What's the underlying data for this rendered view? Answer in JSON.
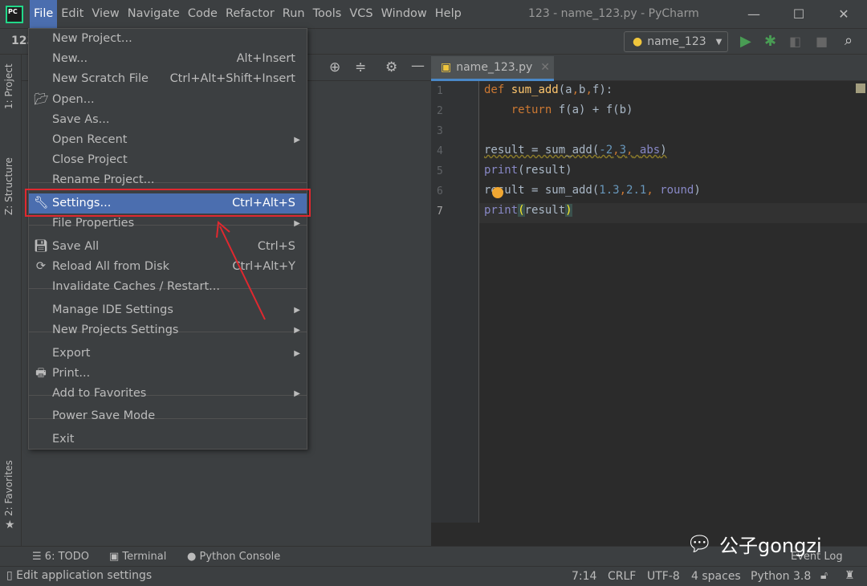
{
  "menubar": {
    "items": [
      "File",
      "Edit",
      "View",
      "Navigate",
      "Code",
      "Refactor",
      "Run",
      "Tools",
      "VCS",
      "Window",
      "Help"
    ],
    "active": "File"
  },
  "window_title": "123 - name_123.py - PyCharm",
  "project_crumb": "123",
  "run_config": "name_123",
  "left_tabs": [
    "1: Project",
    "Z: Structure",
    "2: Favorites"
  ],
  "editor": {
    "tab": "name_123.py",
    "lines": [
      "1",
      "2",
      "3",
      "4",
      "5",
      "6",
      "7"
    ],
    "current_line": 7
  },
  "file_menu": [
    {
      "label": "New Project...",
      "shortcut": "",
      "submenu": false,
      "icon": ""
    },
    {
      "label": "New...",
      "shortcut": "Alt+Insert",
      "submenu": false,
      "icon": ""
    },
    {
      "label": "New Scratch File",
      "shortcut": "Ctrl+Alt+Shift+Insert",
      "submenu": false,
      "icon": ""
    },
    {
      "label": "Open...",
      "shortcut": "",
      "submenu": false,
      "icon": "folder-icon"
    },
    {
      "label": "Save As...",
      "shortcut": "",
      "submenu": false,
      "icon": ""
    },
    {
      "label": "Open Recent",
      "shortcut": "",
      "submenu": true,
      "icon": ""
    },
    {
      "label": "Close Project",
      "shortcut": "",
      "submenu": false,
      "icon": ""
    },
    {
      "label": "Rename Project...",
      "shortcut": "",
      "submenu": false,
      "icon": ""
    },
    {
      "label": "Settings...",
      "shortcut": "Ctrl+Alt+S",
      "submenu": false,
      "icon": "wrench-icon",
      "highlighted": true
    },
    {
      "label": "File Properties",
      "shortcut": "",
      "submenu": true,
      "icon": ""
    },
    {
      "label": "Save All",
      "shortcut": "Ctrl+S",
      "submenu": false,
      "icon": "save-icon"
    },
    {
      "label": "Reload All from Disk",
      "shortcut": "Ctrl+Alt+Y",
      "submenu": false,
      "icon": "reload-icon"
    },
    {
      "label": "Invalidate Caches / Restart...",
      "shortcut": "",
      "submenu": false,
      "icon": ""
    },
    {
      "label": "Manage IDE Settings",
      "shortcut": "",
      "submenu": true,
      "icon": ""
    },
    {
      "label": "New Projects Settings",
      "shortcut": "",
      "submenu": true,
      "icon": ""
    },
    {
      "label": "Export",
      "shortcut": "",
      "submenu": true,
      "icon": ""
    },
    {
      "label": "Print...",
      "shortcut": "",
      "submenu": false,
      "icon": "printer-icon"
    },
    {
      "label": "Add to Favorites",
      "shortcut": "",
      "submenu": true,
      "icon": ""
    },
    {
      "label": "Power Save Mode",
      "shortcut": "",
      "submenu": false,
      "icon": ""
    },
    {
      "label": "Exit",
      "shortcut": "",
      "submenu": false,
      "icon": ""
    }
  ],
  "bottom_tools": [
    "6: TODO",
    "Terminal",
    "Python Console",
    "Event Log"
  ],
  "status": {
    "message": "Edit application settings",
    "position": "7:14",
    "line_sep": "CRLF",
    "encoding": "UTF-8",
    "indent": "4 spaces",
    "interpreter": "Python 3.8"
  },
  "watermark": "公子gongzi",
  "colors": {
    "accent": "#4b6eaf",
    "annotation": "#e0282f",
    "keyword": "#cc7832",
    "function": "#ffc66d",
    "number": "#6897bb",
    "builtin": "#8888c6"
  }
}
